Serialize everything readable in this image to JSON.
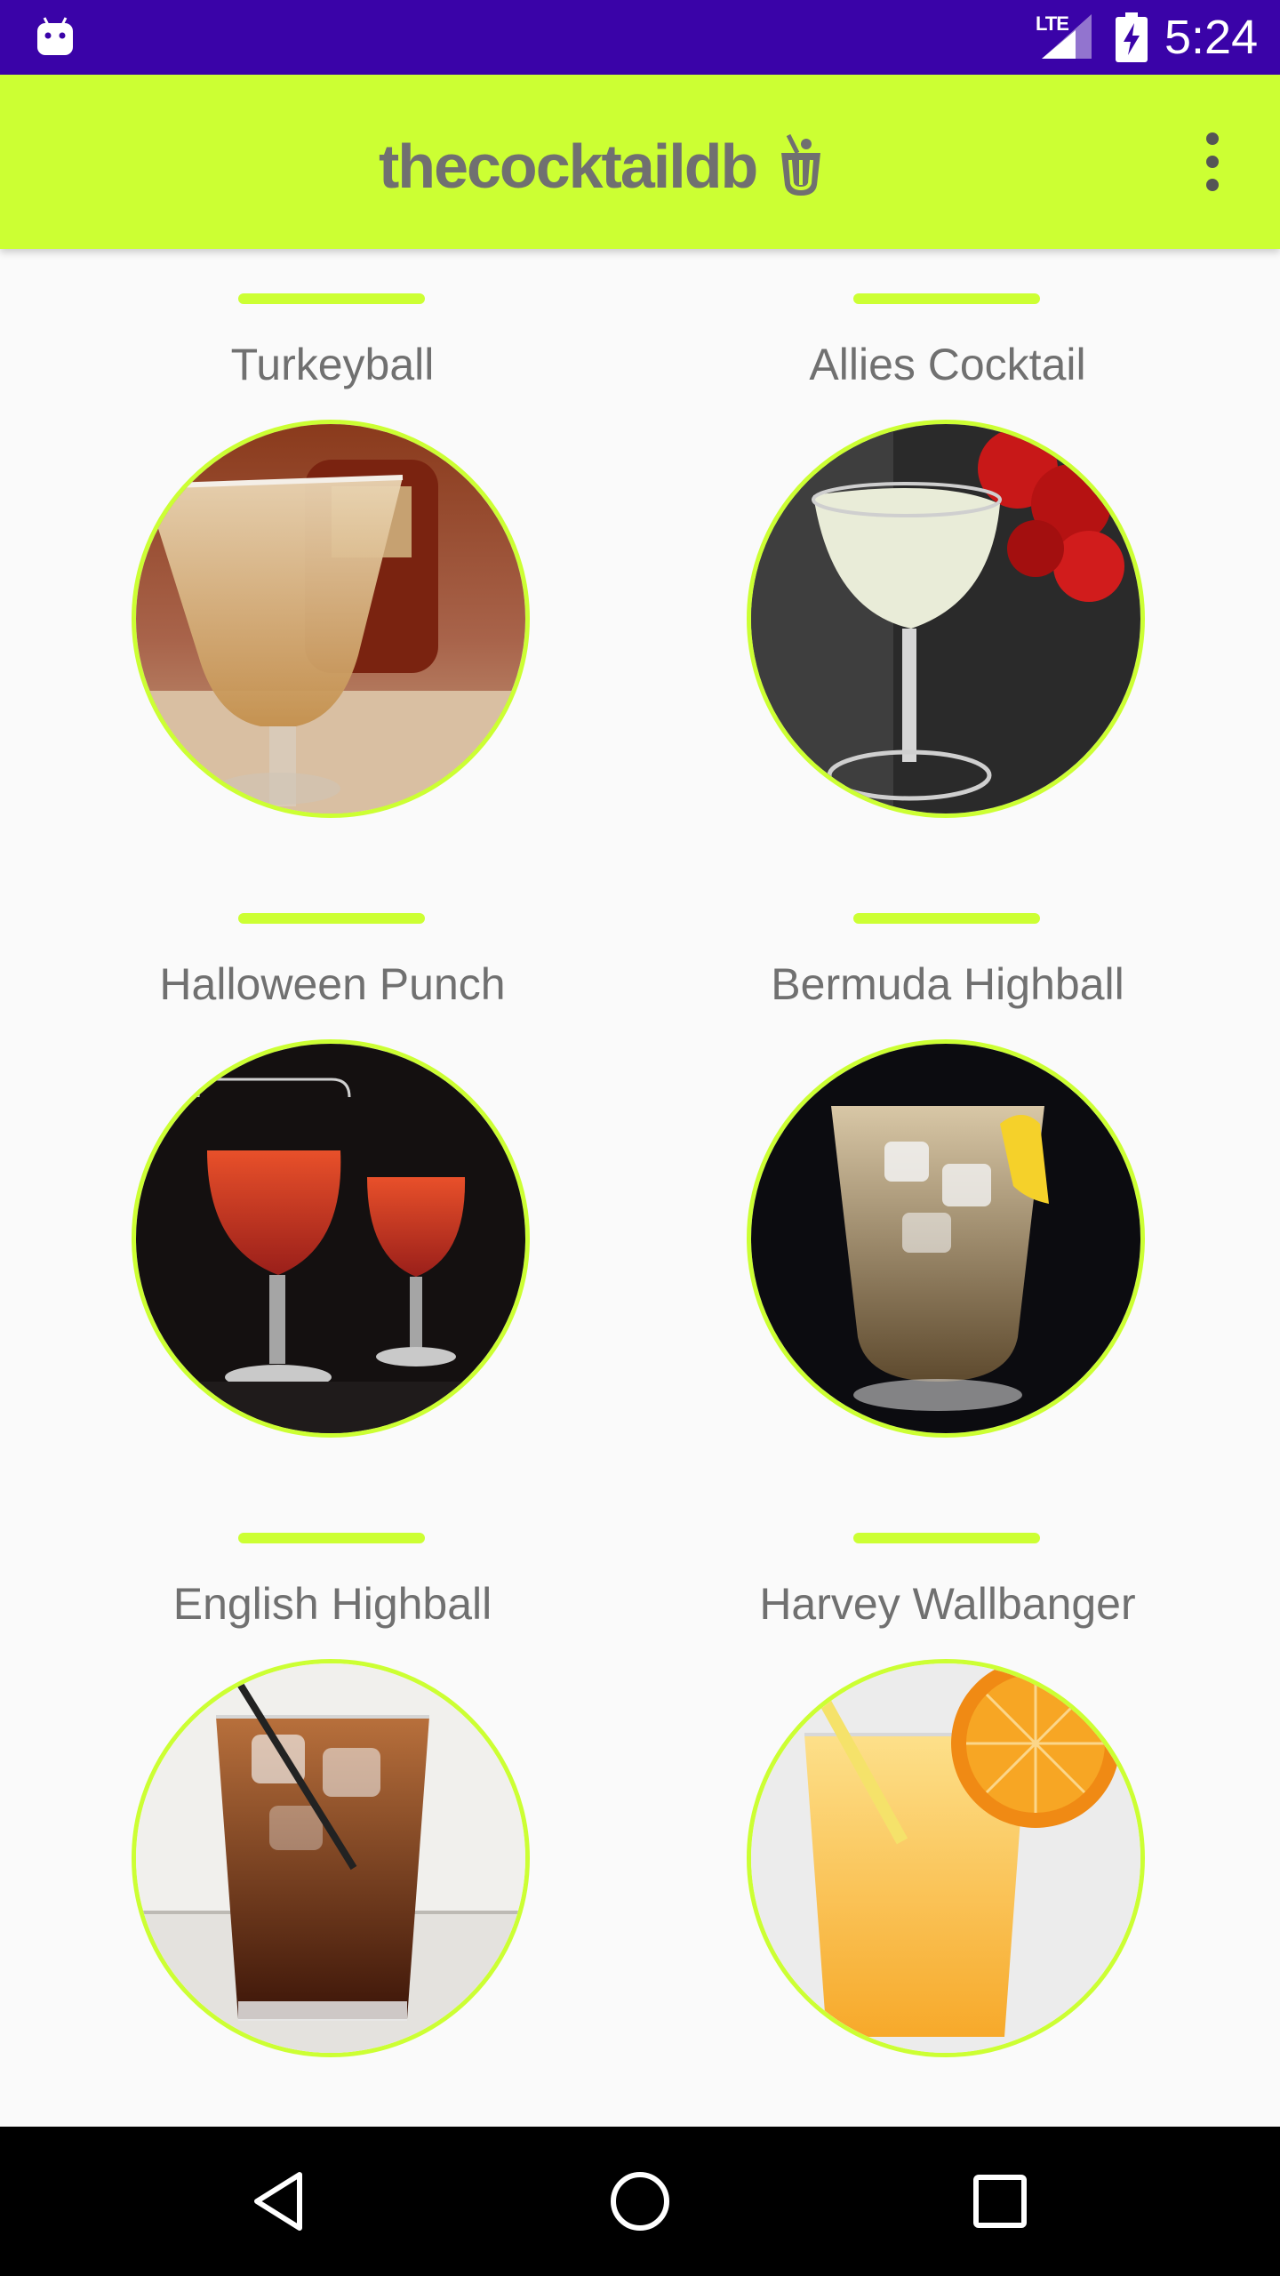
{
  "status_bar": {
    "network": "LTE",
    "time": "5:24",
    "background": "#3a03a8"
  },
  "app_bar": {
    "logo_text": "thecocktaildb",
    "background": "#ccff33",
    "icons": {
      "logo": "cocktail-glass-icon",
      "menu": "overflow-menu-icon"
    }
  },
  "cocktails": [
    {
      "name": "Turkeyball"
    },
    {
      "name": "Allies Cocktail"
    },
    {
      "name": "Halloween Punch"
    },
    {
      "name": "Bermuda Highball"
    },
    {
      "name": "English Highball"
    },
    {
      "name": "Harvey Wallbanger"
    }
  ],
  "nav_bar": {
    "icons": [
      "back-icon",
      "home-icon",
      "recents-icon"
    ]
  },
  "colors": {
    "accent": "#ccff33",
    "text": "#707070"
  }
}
